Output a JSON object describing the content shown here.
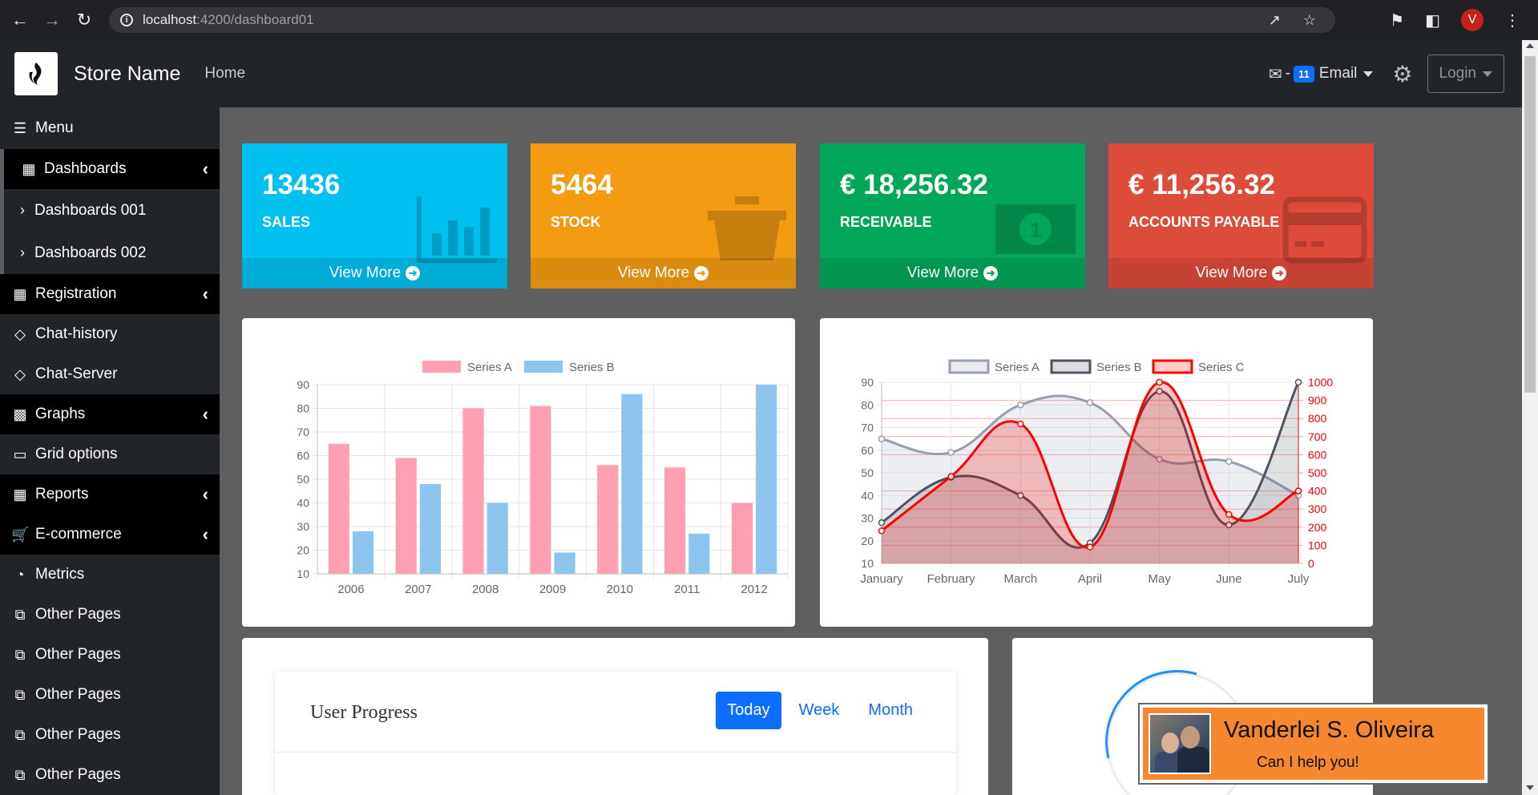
{
  "browser": {
    "url_host": "localhost",
    "url_path": ":4200/dashboard01",
    "profile_initial": "V"
  },
  "header": {
    "store_name": "Store Name",
    "home": "Home",
    "email_count": "11",
    "email_label": "Email",
    "email_sep": "-",
    "login_label": "Login"
  },
  "sidebar": {
    "items": [
      {
        "label": "Menu",
        "icon": "menu-lines-icon"
      },
      {
        "label": "Dashboards",
        "icon": "grid-icon"
      },
      {
        "label": "Dashboards 001"
      },
      {
        "label": "Dashboards 002"
      },
      {
        "label": "Registration",
        "icon": "grid-icon"
      },
      {
        "label": "Chat-history",
        "icon": "diamond-icon"
      },
      {
        "label": "Chat-Server",
        "icon": "diamond-icon"
      },
      {
        "label": "Graphs",
        "icon": "bar-chart-icon"
      },
      {
        "label": "Grid options",
        "icon": "laptop-icon"
      },
      {
        "label": "Reports",
        "icon": "table-icon"
      },
      {
        "label": "E-commerce",
        "icon": "cart-icon"
      },
      {
        "label": "Metrics",
        "icon": "pie-chart-icon"
      },
      {
        "label": "Other Pages",
        "icon": "copy-icon"
      },
      {
        "label": "Other Pages",
        "icon": "copy-icon"
      },
      {
        "label": "Other Pages",
        "icon": "copy-icon"
      },
      {
        "label": "Other Pages",
        "icon": "copy-icon"
      },
      {
        "label": "Other Pages",
        "icon": "copy-icon"
      }
    ]
  },
  "cards": [
    {
      "value": "13436",
      "label": "SALES",
      "footer": "View More",
      "color": "#00c0ef",
      "icon": "bar-chart-icon"
    },
    {
      "value": "5464",
      "label": "STOCK",
      "footer": "View More",
      "color": "#f39c12",
      "icon": "basket-icon"
    },
    {
      "value": "€ 18,256.32",
      "label": "RECEIVABLE",
      "footer": "View More",
      "color": "#00a65a",
      "icon": "money-icon"
    },
    {
      "value": "€ 11,256.32",
      "label": "ACCOUNTS PAYABLE",
      "footer": "View More",
      "color": "#dd4b39",
      "icon": "credit-card-icon"
    }
  ],
  "chart_data": [
    {
      "type": "bar",
      "categories": [
        "2006",
        "2007",
        "2008",
        "2009",
        "2010",
        "2011",
        "2012"
      ],
      "series": [
        {
          "name": "Series A",
          "values": [
            65,
            59,
            80,
            81,
            56,
            55,
            40
          ],
          "color": "#ff9fb4"
        },
        {
          "name": "Series B",
          "values": [
            28,
            48,
            40,
            19,
            86,
            27,
            90
          ],
          "color": "#8cc4ee"
        }
      ],
      "ylim": [
        10,
        90
      ],
      "yticks": [
        10,
        20,
        30,
        40,
        50,
        60,
        70,
        80,
        90
      ],
      "legend": "top",
      "grid": true
    },
    {
      "type": "line",
      "categories": [
        "January",
        "February",
        "March",
        "April",
        "May",
        "June",
        "July"
      ],
      "series": [
        {
          "name": "Series A",
          "values": [
            65,
            59,
            80,
            81,
            56,
            55,
            40
          ],
          "axis": "left",
          "color": "#949fb1",
          "fill": true
        },
        {
          "name": "Series B",
          "values": [
            28,
            48,
            40,
            19,
            86,
            27,
            90
          ],
          "axis": "left",
          "color": "#4d5360",
          "fill": true
        },
        {
          "name": "Series C",
          "values": [
            180,
            480,
            770,
            90,
            1000,
            270,
            400
          ],
          "axis": "right",
          "color": "#ff0000",
          "fill": true
        }
      ],
      "ylim": [
        10,
        90
      ],
      "yticks": [
        10,
        20,
        30,
        40,
        50,
        60,
        70,
        80,
        90
      ],
      "y2lim": [
        0,
        1000
      ],
      "y2ticks": [
        0,
        100,
        200,
        300,
        400,
        500,
        600,
        700,
        800,
        900,
        1000
      ],
      "legend": "top",
      "grid": true
    }
  ],
  "progress": {
    "title": "User Progress",
    "tabs": [
      "Today",
      "Week",
      "Month"
    ]
  },
  "help": {
    "name": "Vanderlei S. Oliveira",
    "text": "Can I help you!"
  }
}
